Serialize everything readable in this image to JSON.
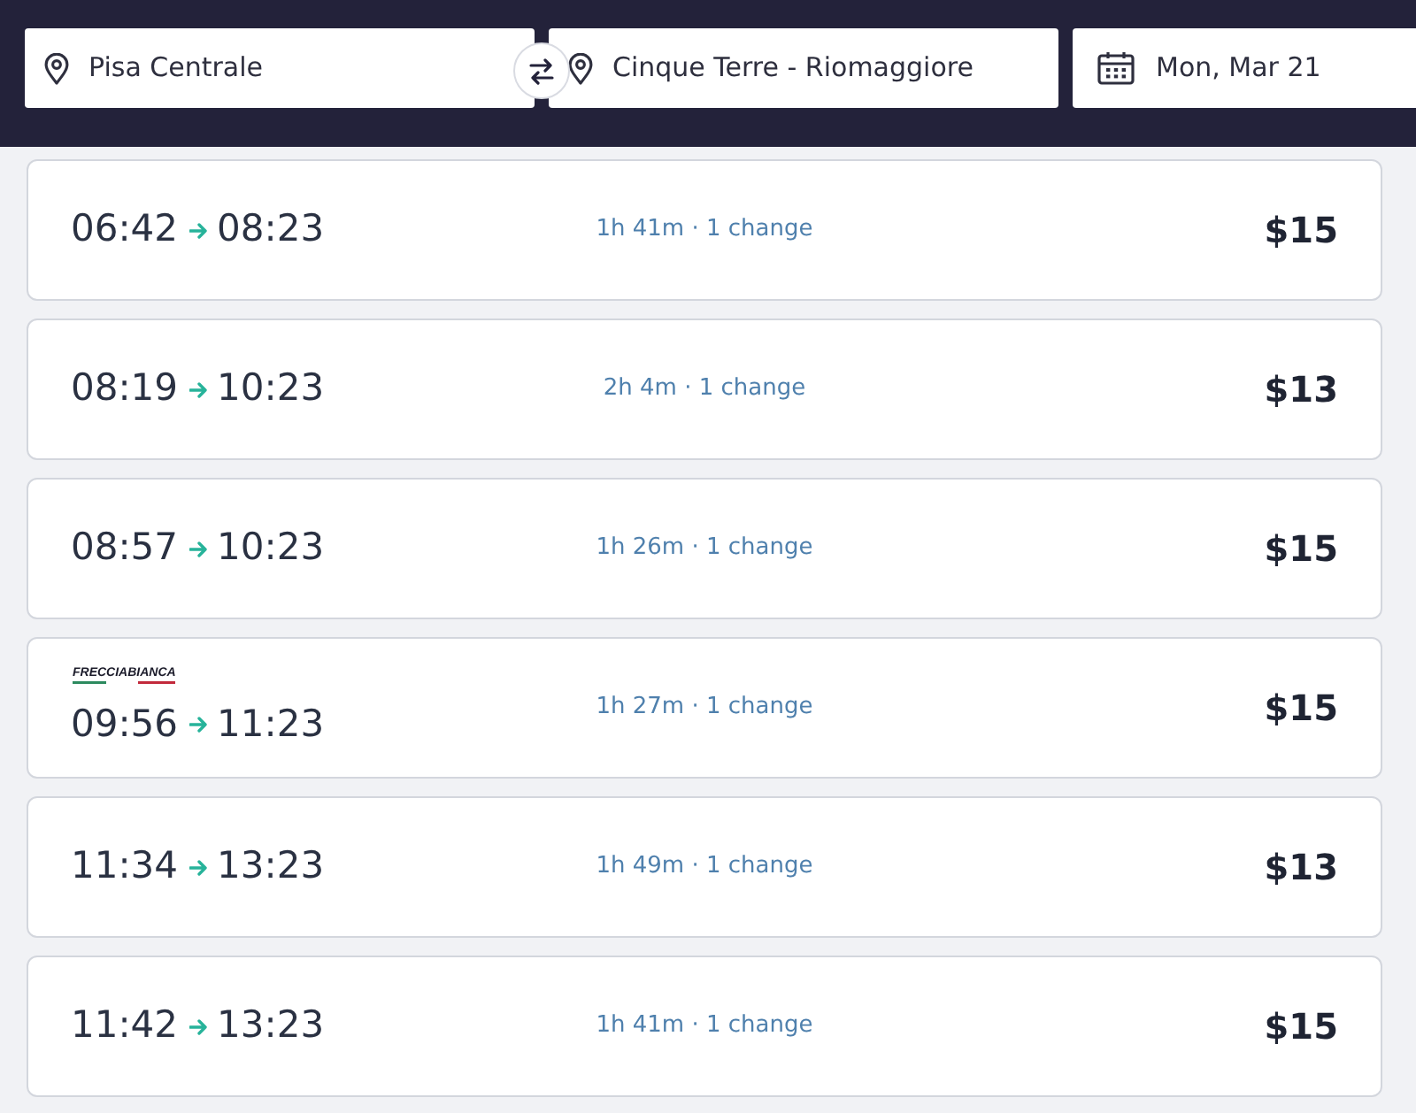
{
  "search": {
    "origin": "Pisa Centrale",
    "destination": "Cinque Terre - Riomaggiore",
    "date": "Mon, Mar 21"
  },
  "trips": [
    {
      "departure": "06:42",
      "arrival": "08:23",
      "duration": "1h 41m · 1 change",
      "price": "$15"
    },
    {
      "departure": "08:19",
      "arrival": "10:23",
      "duration": "2h 4m · 1 change",
      "price": "$13"
    },
    {
      "departure": "08:57",
      "arrival": "10:23",
      "duration": "1h 26m · 1 change",
      "price": "$15"
    },
    {
      "operator": "FRECCIABIANCA",
      "departure": "09:56",
      "arrival": "11:23",
      "duration": "1h 27m · 1 change",
      "price": "$15"
    },
    {
      "departure": "11:34",
      "arrival": "13:23",
      "duration": "1h 49m · 1 change",
      "price": "$13"
    },
    {
      "departure": "11:42",
      "arrival": "13:23",
      "duration": "1h 41m · 1 change",
      "price": "$15"
    }
  ]
}
